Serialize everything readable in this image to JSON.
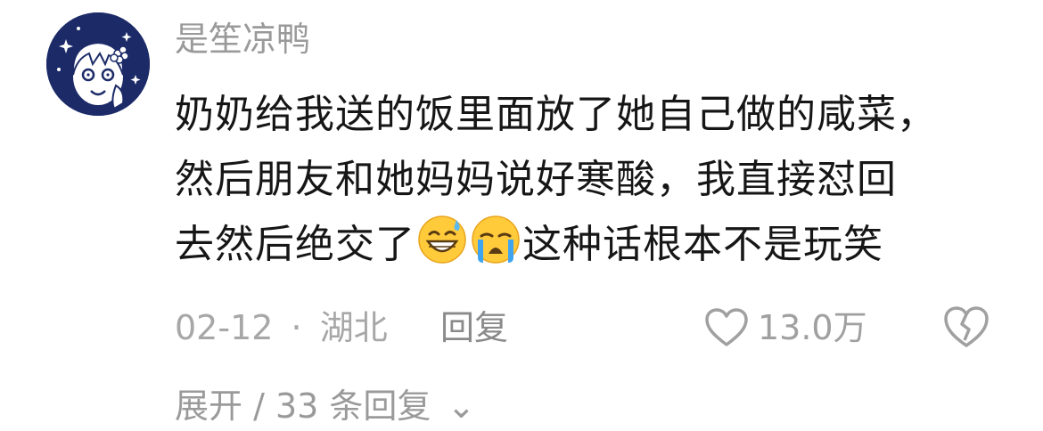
{
  "comment": {
    "username": "是笙凉鸭",
    "avatar_icon": "anime-avatar-icon",
    "text_lines": [
      "奶奶给我送的饭里面放了她自己做的咸菜，",
      "然后朋友和她妈妈说好寒酸，我直接怼回",
      "去然后绝交了"
    ],
    "text_after_emoji": "这种话根本不是玩笑",
    "emojis": [
      "grinning-sweat-emoji",
      "loudly-crying-emoji"
    ],
    "date": "02-12",
    "separator": "·",
    "location": "湖北",
    "reply_label": "回复",
    "like_count": "13.0万",
    "like_icon": "heart-outline-icon",
    "dislike_icon": "broken-heart-icon",
    "expand_label": "展开 / 33 条回复",
    "expand_icon": "chevron-down-icon"
  },
  "colors": {
    "background": "#ffffff",
    "text_primary": "#161616",
    "text_muted": "#a7a7a7",
    "avatar_bg": "#1c2b68"
  }
}
